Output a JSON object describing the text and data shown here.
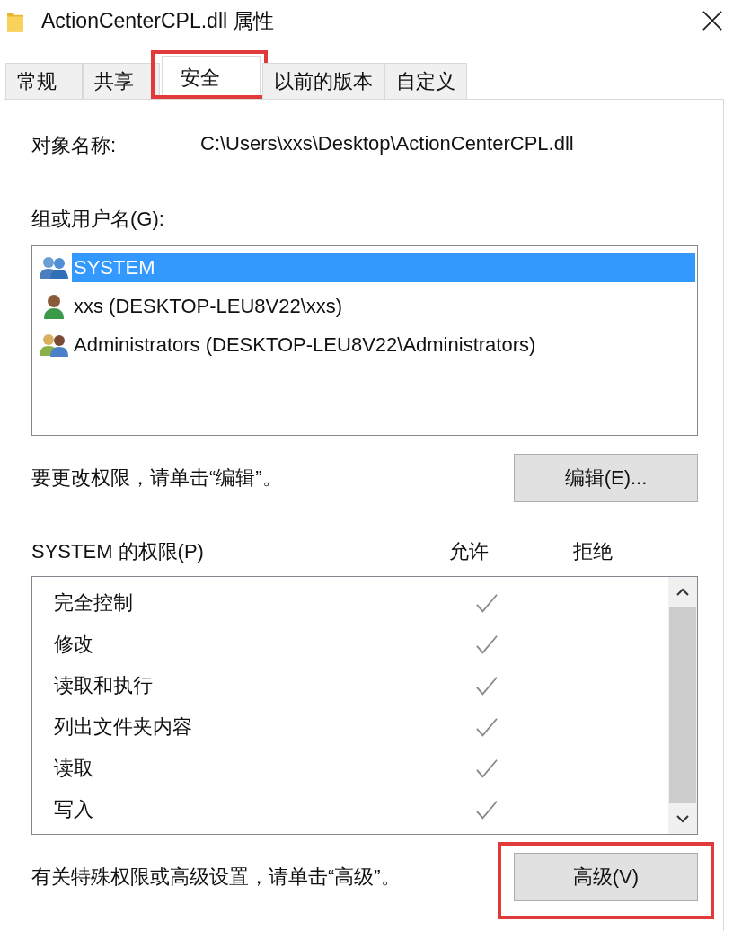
{
  "window": {
    "title": "ActionCenterCPL.dll 属性"
  },
  "tabs": [
    {
      "label": "常规",
      "selected": false,
      "highlighted": false
    },
    {
      "label": "共享",
      "selected": false,
      "highlighted": false
    },
    {
      "label": "安全",
      "selected": true,
      "highlighted": true
    },
    {
      "label": "以前的版本",
      "selected": false,
      "highlighted": false
    },
    {
      "label": "自定义",
      "selected": false,
      "highlighted": false
    }
  ],
  "object_name": {
    "label": "对象名称:",
    "value": "C:\\Users\\xxs\\Desktop\\ActionCenterCPL.dll"
  },
  "groups": {
    "label": "组或用户名(G):",
    "items": [
      {
        "name": "SYSTEM",
        "kind": "group",
        "selected": true
      },
      {
        "name": "xxs (DESKTOP-LEU8V22\\xxs)",
        "kind": "user",
        "selected": false
      },
      {
        "name": "Administrators (DESKTOP-LEU8V22\\Administrators)",
        "kind": "admins",
        "selected": false
      }
    ]
  },
  "edit_hint": "要更改权限，请单击“编辑”。",
  "edit_button": {
    "label": "编辑(E)..."
  },
  "permissions": {
    "label": "SYSTEM 的权限(P)",
    "allow_header": "允许",
    "deny_header": "拒绝",
    "rows": [
      {
        "name": "完全控制",
        "allow": true
      },
      {
        "name": "修改",
        "allow": true
      },
      {
        "name": "读取和执行",
        "allow": true
      },
      {
        "name": "列出文件夹内容",
        "allow": true
      },
      {
        "name": "读取",
        "allow": true
      },
      {
        "name": "写入",
        "allow": true
      }
    ]
  },
  "advanced_hint": "有关特殊权限或高级设置，请单击“高级”。",
  "advanced_button": {
    "label": "高级(V)",
    "highlighted": true
  }
}
